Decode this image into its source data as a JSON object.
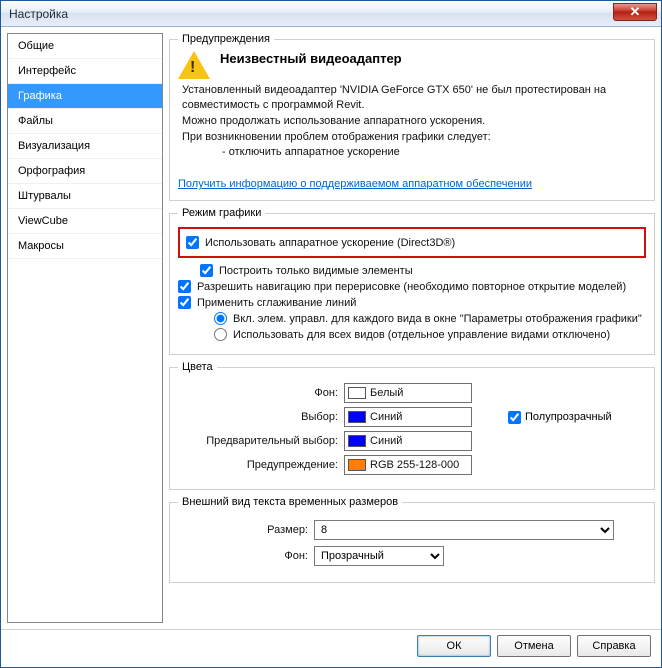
{
  "window": {
    "title": "Настройка"
  },
  "sidebar": {
    "items": [
      {
        "label": "Общие"
      },
      {
        "label": "Интерфейс"
      },
      {
        "label": "Графика"
      },
      {
        "label": "Файлы"
      },
      {
        "label": "Визуализация"
      },
      {
        "label": "Орфография"
      },
      {
        "label": "Штурвалы"
      },
      {
        "label": "ViewCube"
      },
      {
        "label": "Макросы"
      }
    ],
    "active_index": 2
  },
  "warning": {
    "legend": "Предупреждения",
    "title": "Неизвестный видеоадаптер",
    "line1": "Установленный видеоадаптер 'NVIDIA GeForce GTX 650' не был протестирован на совместимость с программой Revit.",
    "line2": "Можно продолжать использование аппаратного ускорения.",
    "line3": "При возникновении проблем отображения графики следует:",
    "bullet": "- отключить аппаратное ускорение",
    "link": "Получить информацию о поддерживаемом аппаратном обеспечении"
  },
  "graphics": {
    "legend": "Режим графики",
    "hw_accel": "Использовать аппаратное ускорение (Direct3D®)",
    "visible_only": "Построить только видимые элементы",
    "nav_redraw": "Разрешить навигацию при перерисовке (необходимо повторное открытие моделей)",
    "smoothing": "Применить сглаживание линий",
    "radio_per_view": "Вкл. элем. управл. для каждого вида в окне \"Параметры отображения графики\"",
    "radio_all_views": "Использовать для всех видов (отдельное управление видами отключено)"
  },
  "colors": {
    "legend": "Цвета",
    "bg_label": "Фон:",
    "bg_value": "Белый",
    "bg_hex": "#ffffff",
    "sel_label": "Выбор:",
    "sel_value": "Синий",
    "sel_hex": "#0000ff",
    "semi_label": "Полупрозрачный",
    "pre_label": "Предварительный выбор:",
    "pre_value": "Синий",
    "pre_hex": "#0000ff",
    "warn_label": "Предупреждение:",
    "warn_value": "RGB 255-128-000",
    "warn_hex": "#ff8000"
  },
  "tempdim": {
    "legend": "Внешний вид текста временных размеров",
    "size_label": "Размер:",
    "size_value": "8",
    "bg_label": "Фон:",
    "bg_value": "Прозрачный"
  },
  "footer": {
    "ok": "ОК",
    "cancel": "Отмена",
    "help": "Справка"
  }
}
